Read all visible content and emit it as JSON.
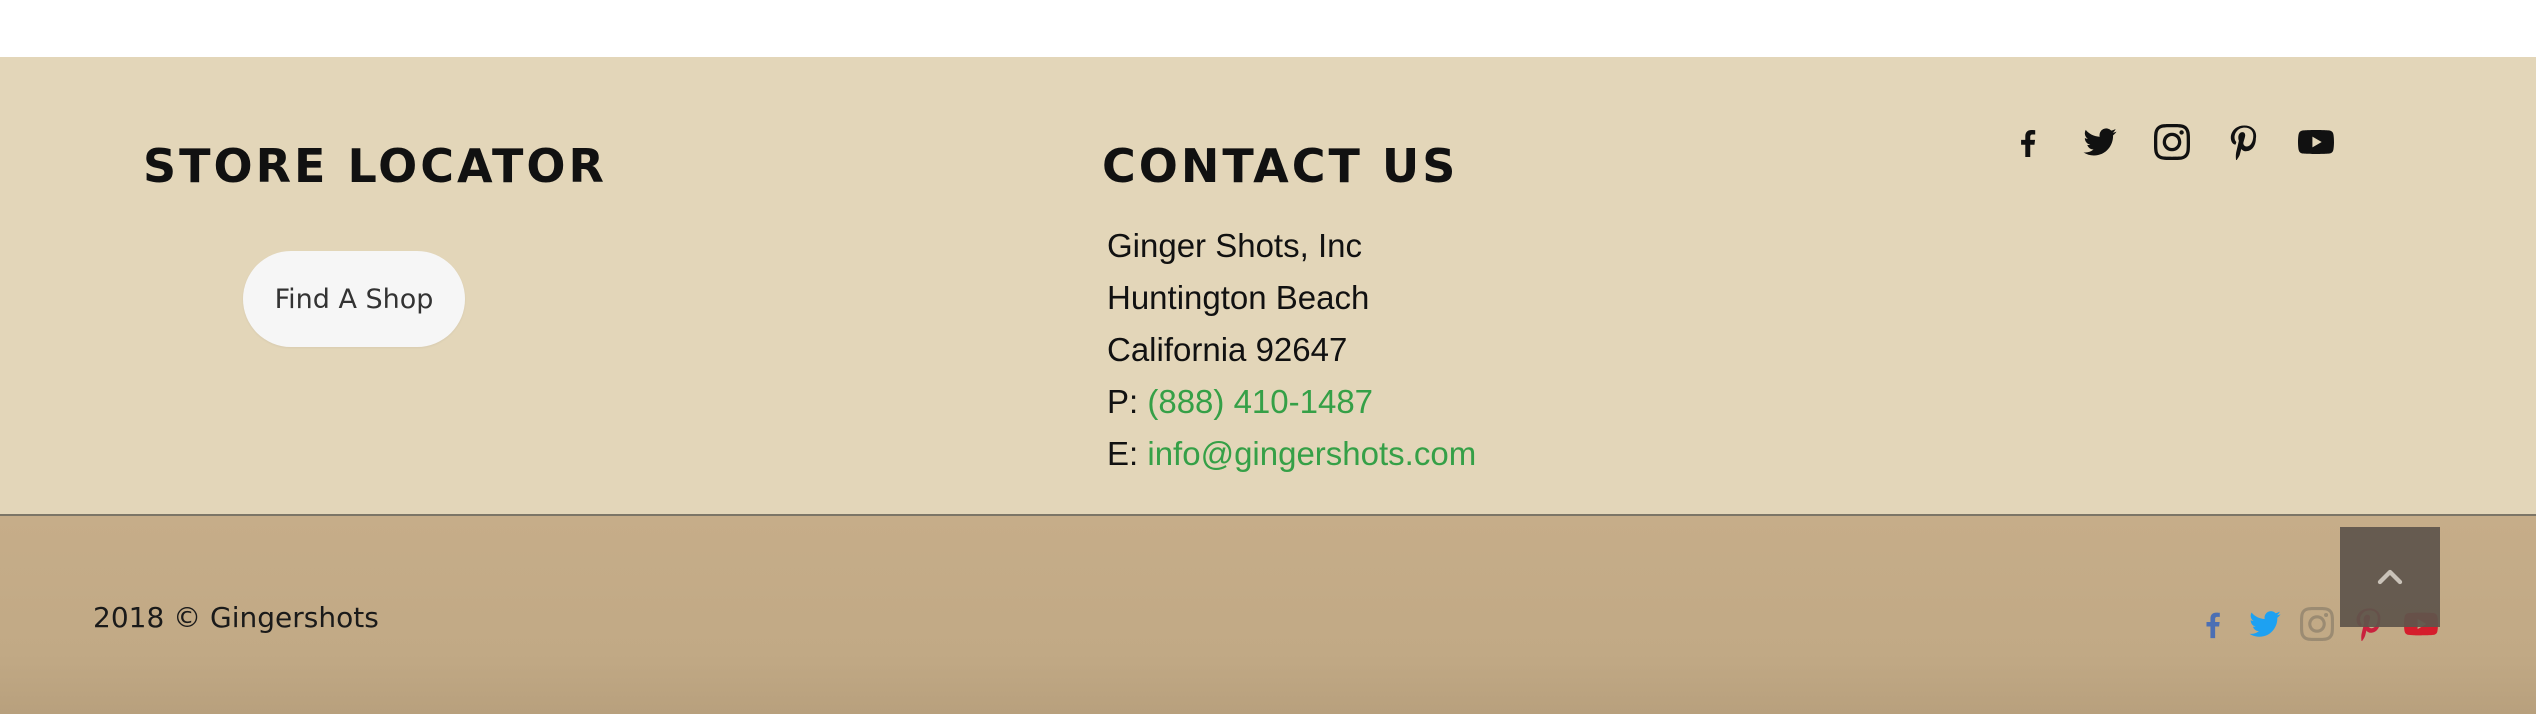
{
  "store_locator": {
    "heading": "STORE LOCATOR",
    "button_label": "Find A Shop"
  },
  "contact": {
    "heading": "CONTACT US",
    "company": "Ginger Shots, Inc",
    "city": "Huntington Beach",
    "state_zip": "California 92647",
    "phone_prefix": "P: ",
    "phone": "(888) 410-1487",
    "email_prefix": "E: ",
    "email": "info@gingershots.com",
    "link_color": "#35a047"
  },
  "social_top": [
    {
      "icon": "facebook-icon",
      "color": "#111111"
    },
    {
      "icon": "twitter-icon",
      "color": "#111111"
    },
    {
      "icon": "instagram-icon",
      "color": "#111111"
    },
    {
      "icon": "pinterest-icon",
      "color": "#111111"
    },
    {
      "icon": "youtube-icon",
      "color": "#111111"
    }
  ],
  "bottom_bar": {
    "copyright": "2018 © Gingershots",
    "social": [
      {
        "icon": "facebook-icon",
        "color": "#4b6fb4"
      },
      {
        "icon": "twitter-icon",
        "color": "#1da1f2"
      },
      {
        "icon": "instagram-icon",
        "color": "#9b8b72"
      },
      {
        "icon": "pinterest-icon",
        "color": "#c9213d"
      },
      {
        "icon": "youtube-icon",
        "color": "#d51d2c"
      }
    ],
    "back_to_top_icon": "chevron-up-icon"
  },
  "colors": {
    "footer_bg": "#e3d6b9",
    "bottom_bg": "#c4ab87",
    "back_to_top_bg": "#5f554b"
  }
}
